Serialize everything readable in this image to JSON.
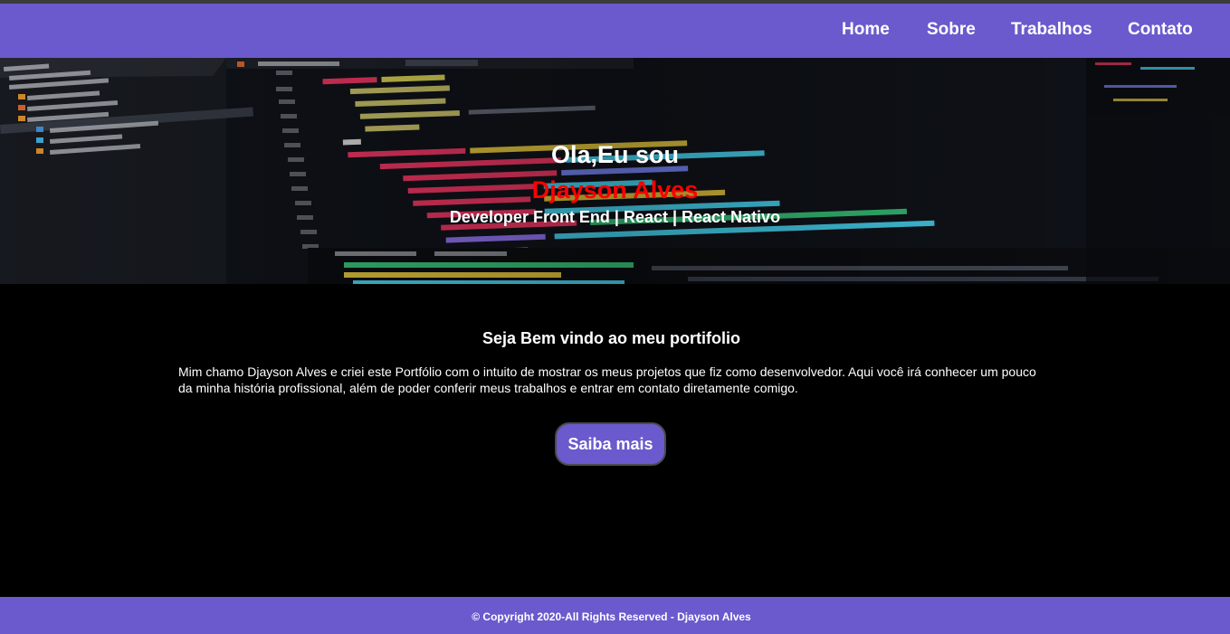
{
  "nav": {
    "items": [
      {
        "label": "Home"
      },
      {
        "label": "Sobre"
      },
      {
        "label": "Trabalhos"
      },
      {
        "label": "Contato"
      }
    ]
  },
  "hero": {
    "greeting": "Ola,Eu sou",
    "name": "Djayson Alves",
    "role": "Developer Front End | React | React Nativo",
    "background": "code-editor-photo"
  },
  "about": {
    "title": "Seja Bem vindo ao meu portifolio",
    "text": "Mim chamo Djayson Alves e criei este Portfólio com o intuito de mostrar os meus projetos que fiz como desenvolvedor. Aqui você irá conhecer um pouco da minha história profissional, além de poder conferir meus trabalhos e entrar em contato diretamente comigo.",
    "button_label": "Saiba mais"
  },
  "footer": {
    "copyright": "© Copyright 2020-All Rights Reserved - Djayson Alves"
  },
  "colors": {
    "brand": "#6a5acd",
    "name_highlight": "#ff0000",
    "background": "#000000"
  }
}
